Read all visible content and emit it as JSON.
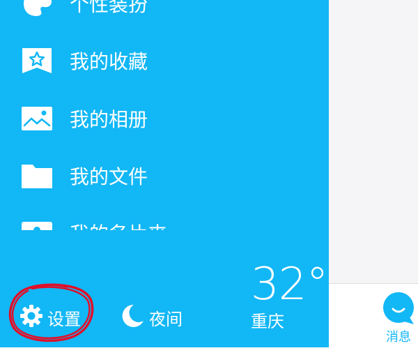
{
  "drawer": {
    "menu": [
      {
        "label": "个性装扮",
        "icon": "palette-icon"
      },
      {
        "label": "我的收藏",
        "icon": "star-bookmark-icon"
      },
      {
        "label": "我的相册",
        "icon": "photo-album-icon"
      },
      {
        "label": "我的文件",
        "icon": "folder-icon"
      },
      {
        "label": "我的名片夹",
        "icon": "business-card-icon"
      }
    ],
    "bottom": {
      "settings_label": "设置",
      "night_label": "夜间",
      "temperature": "32°",
      "city": "重庆"
    }
  },
  "tabbar": {
    "messages_label": "消息"
  },
  "colors": {
    "accent": "#12B7F5",
    "annotation": "#E0102A"
  }
}
